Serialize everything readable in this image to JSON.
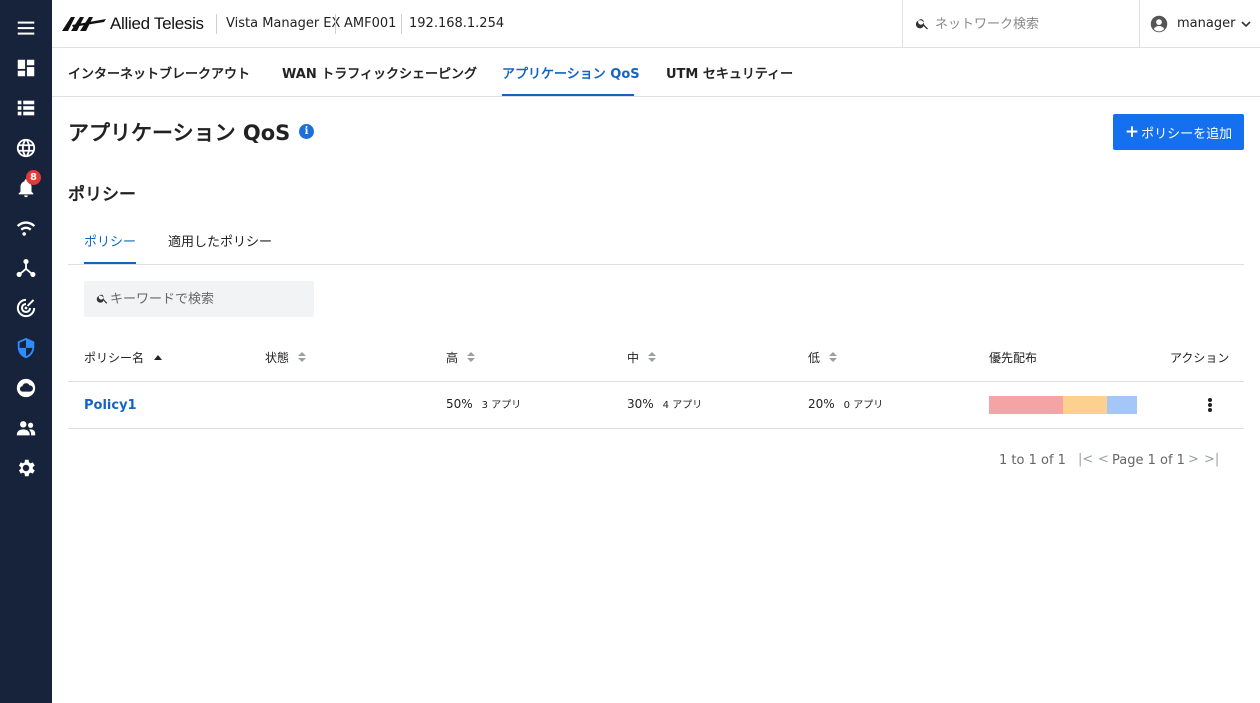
{
  "sidebar": {
    "items": [
      {
        "name": "menu-icon",
        "label": "menu"
      },
      {
        "name": "dashboard-icon",
        "label": "dashboard"
      },
      {
        "name": "list-icon",
        "label": "list"
      },
      {
        "name": "globe-icon",
        "label": "globe"
      },
      {
        "name": "bell-icon",
        "label": "alerts",
        "badge": "8"
      },
      {
        "name": "wifi-icon",
        "label": "wifi"
      },
      {
        "name": "topology-icon",
        "label": "topology"
      },
      {
        "name": "radar-icon",
        "label": "radar"
      },
      {
        "name": "shield-icon",
        "label": "security",
        "active": true
      },
      {
        "name": "cloud-icon",
        "label": "cloud"
      },
      {
        "name": "users-icon",
        "label": "users"
      },
      {
        "name": "settings-icon",
        "label": "settings"
      }
    ]
  },
  "header": {
    "logo_text": "Allied Telesis",
    "product": "Vista Manager EX",
    "device": "AMF001",
    "ip": "192.168.1.254",
    "search_placeholder": "ネットワーク検索",
    "username": "manager"
  },
  "top_tabs": [
    {
      "label": "インターネットブレークアウト"
    },
    {
      "label": "WAN トラフィックシェーピング"
    },
    {
      "label": "アプリケーション QoS",
      "active": true
    },
    {
      "label": "UTM セキュリティー"
    }
  ],
  "page": {
    "title": "アプリケーション QoS",
    "info_glyph": "i",
    "add_button": "ポリシーを追加",
    "add_plus": "+",
    "section_title": "ポリシー"
  },
  "sub_tabs": [
    {
      "label": "ポリシー",
      "active": true
    },
    {
      "label": "適用したポリシー"
    }
  ],
  "keyword_search": {
    "placeholder": "キーワードで検索"
  },
  "table": {
    "headers": {
      "name": "ポリシー名",
      "status": "状態",
      "high": "高",
      "medium": "中",
      "low": "低",
      "distribution": "優先配布",
      "actions": "アクション"
    },
    "rows": [
      {
        "name": "Policy1",
        "status": "",
        "high_pct": "50%",
        "high_apps": "3 アプリ",
        "medium_pct": "30%",
        "medium_apps": "4 アプリ",
        "low_pct": "20%",
        "low_apps": "0 アプリ",
        "distribution": [
          {
            "level": "high",
            "fraction": 0.5,
            "color": "#f4a3a6"
          },
          {
            "level": "medium",
            "fraction": 0.3,
            "color": "#fcd08f"
          },
          {
            "level": "low",
            "fraction": 0.2,
            "color": "#a5c7f7"
          }
        ]
      }
    ]
  },
  "pagination": {
    "range": "1 to 1 of 1",
    "page": "Page 1 of 1",
    "first": "|<",
    "prev": "<",
    "next": ">",
    "last": ">|"
  },
  "colors": {
    "sidebar_bg": "#17233b",
    "accent": "#1565c0",
    "button": "#1570ef",
    "badge": "#e53935"
  }
}
